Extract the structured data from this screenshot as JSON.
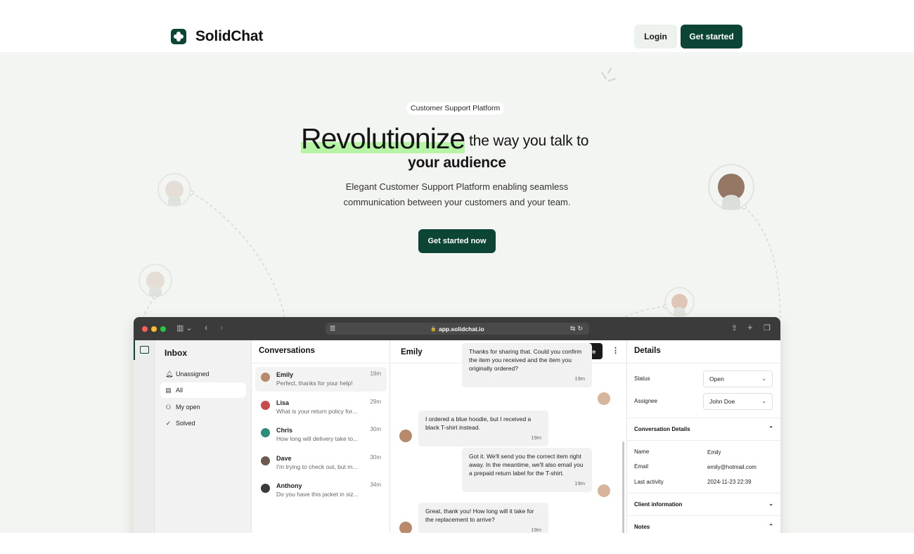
{
  "nav": {
    "brand": "SolidChat",
    "login_label": "Login",
    "get_started_label": "Get started"
  },
  "hero": {
    "badge": "Customer Support Platform",
    "headline_highlight": "Revolutionize",
    "headline_rest": "the way you talk to",
    "headline_line2": "your audience",
    "subtitle_line1": "Elegant Customer Support Platform enabling seamless",
    "subtitle_line2": "communication between your customers and your team.",
    "cta_label": "Get started now"
  },
  "browser": {
    "url": "app.solidchat.io"
  },
  "inbox": {
    "title": "Inbox",
    "items": [
      {
        "label": "Unassigned",
        "icon": "bell-icon"
      },
      {
        "label": "All",
        "icon": "archive-icon"
      },
      {
        "label": "My open",
        "icon": "user-icon"
      },
      {
        "label": "Solved",
        "icon": "check-circle-icon"
      }
    ]
  },
  "conversations": {
    "title": "Conversations",
    "items": [
      {
        "name": "Emily",
        "time": "19m",
        "preview": "Perfect, thanks for your help!"
      },
      {
        "name": "Lisa",
        "time": "29m",
        "preview": "What is your return policy for..."
      },
      {
        "name": "Chris",
        "time": "30m",
        "preview": "How long will delivery take to..."
      },
      {
        "name": "Dave",
        "time": "30m",
        "preview": "I'm trying to check out, but m..."
      },
      {
        "name": "Anthony",
        "time": "34m",
        "preview": "Do you have this jacket in siz..."
      }
    ]
  },
  "chat": {
    "contact": "Emily",
    "resolve_label": "Resolve",
    "messages": [
      {
        "text": "Thanks for sharing that. Could you confirm the item you received and the item you originally ordered?",
        "time": "19m",
        "side": "agent"
      },
      {
        "text": "I ordered a blue hoodie, but I received a black T-shirt instead.",
        "time": "19m",
        "side": "customer"
      },
      {
        "text": "Got it. We'll send you the correct item right away. In the meantime, we'll also email you a prepaid return label for the T-shirt.",
        "time": "19m",
        "side": "agent"
      },
      {
        "text": "Great, thank you! How long will it take for the replacement to arrive?",
        "time": "19m",
        "side": "customer"
      }
    ]
  },
  "details": {
    "title": "Details",
    "status_label": "Status",
    "status_value": "Open",
    "assignee_label": "Assignee",
    "assignee_value": "John Doe",
    "conversation_details_title": "Conversation Details",
    "name_label": "Name",
    "name_value": "Emily",
    "email_label": "Email",
    "email_value": "emily@hotmail.com",
    "last_activity_label": "Last activity",
    "last_activity_value": "2024-11-23 22:39",
    "client_info_title": "Client information",
    "notes_title": "Notes"
  },
  "colors": {
    "brand": "#0c4535",
    "highlight": "#b6f5a6",
    "hero_bg": "#f3f5f2"
  }
}
